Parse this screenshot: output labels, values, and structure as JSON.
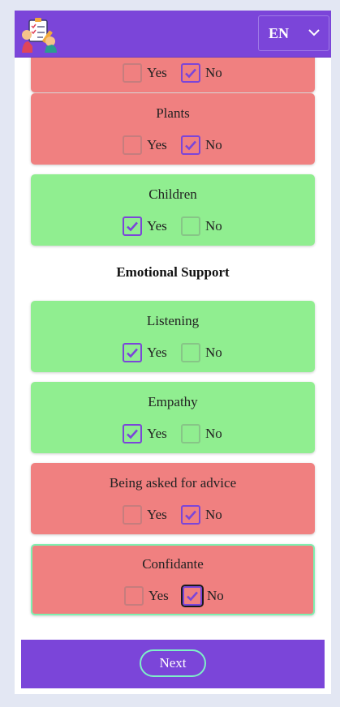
{
  "header": {
    "lang": {
      "label": "EN"
    }
  },
  "section": {
    "title": "Emotional Support"
  },
  "cards": [
    {
      "title": "",
      "yes_label": "Yes",
      "no_label": "No",
      "selected": "No"
    },
    {
      "title": "Plants",
      "yes_label": "Yes",
      "no_label": "No",
      "selected": "No"
    },
    {
      "title": "Children",
      "yes_label": "Yes",
      "no_label": "No",
      "selected": "Yes"
    },
    {
      "title": "Listening",
      "yes_label": "Yes",
      "no_label": "No",
      "selected": "Yes"
    },
    {
      "title": "Empathy",
      "yes_label": "Yes",
      "no_label": "No",
      "selected": "Yes"
    },
    {
      "title": "Being asked for advice",
      "yes_label": "Yes",
      "no_label": "No",
      "selected": "No"
    },
    {
      "title": "Confidante",
      "yes_label": "Yes",
      "no_label": "No",
      "selected": "No"
    }
  ],
  "footer": {
    "next_label": "Next"
  },
  "colors": {
    "brand": "#7b45d9",
    "yes_card": "#90ee90",
    "no_card": "#f08080",
    "focus": "#7ef0c8"
  }
}
